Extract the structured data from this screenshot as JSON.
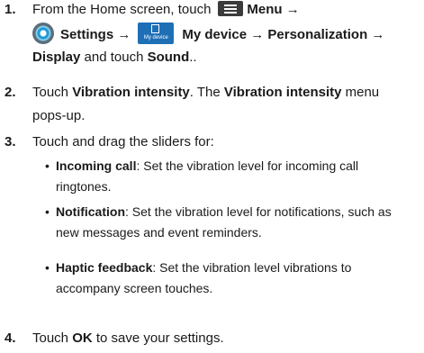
{
  "steps": [
    {
      "num": "1.",
      "a": "From the Home screen, touch",
      "menu": "Menu →",
      "settings": "Settings →",
      "mydevice_icon_label": "My device",
      "mydevice": "My device → Personalization →",
      "display": "Display",
      "and_touch": " and touch ",
      "sound": "Sound",
      "end": ".."
    },
    {
      "num": "2.",
      "a": "Touch ",
      "vib1": "Vibration intensity",
      "b": ". The ",
      "vib2": "Vibration intensity",
      "c": " menu",
      "d": "pops-up."
    },
    {
      "num": "3.",
      "a": "Touch and drag the sliders for:"
    },
    {
      "num": "4.",
      "a": "Touch ",
      "ok": "OK",
      "b": " to save your settings."
    }
  ],
  "bullets": [
    {
      "term": "Incoming call",
      "line1": ": Set the vibration level for incoming call",
      "line2": "ringtones."
    },
    {
      "term": "Notification",
      "line1": ": Set the vibration level for notifications, such as",
      "line2": "new messages and event reminders."
    },
    {
      "term": "Haptic feedback",
      "line1": ": Set the vibration level vibrations to",
      "line2": "accompany screen touches."
    }
  ],
  "icons": {
    "menu": "menu-icon",
    "settings": "gear-icon",
    "my_device": "my-device-icon"
  }
}
